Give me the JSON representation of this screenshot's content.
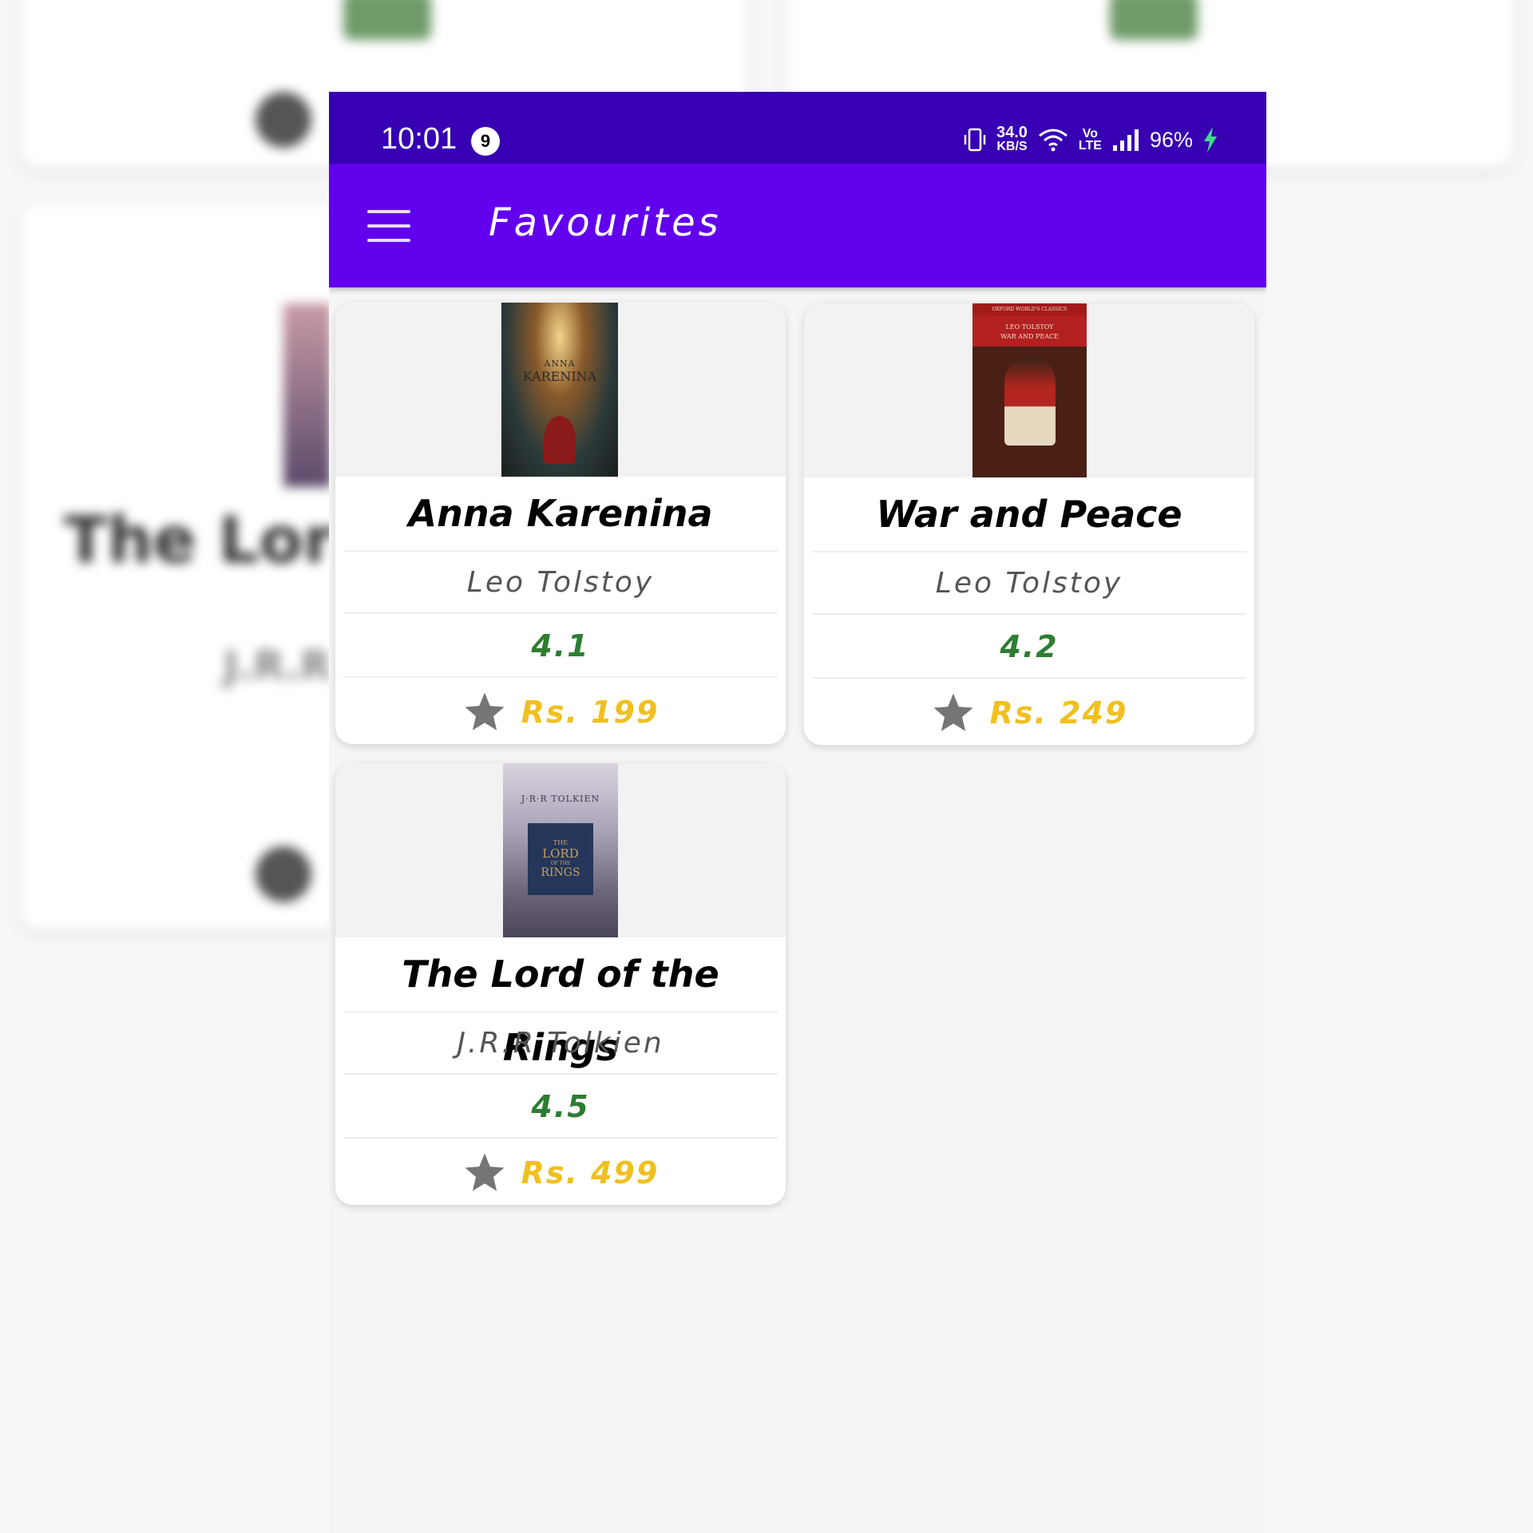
{
  "status_bar": {
    "time": "10:01",
    "notification_count": "9",
    "net_speed_value": "34.0",
    "net_speed_unit": "KB/S",
    "volte_top": "Vo",
    "volte_bottom": "LTE",
    "battery": "96%"
  },
  "app_bar": {
    "title": "Favourites",
    "menu_icon": "hamburger-menu-icon"
  },
  "colors": {
    "status_bar": "#3700b3",
    "app_bar": "#6200ee",
    "rating": "#2e7d32",
    "price": "#f0c020",
    "star": "#757575"
  },
  "books": [
    {
      "title": "Anna Karenina",
      "author": "Leo Tolstoy",
      "rating": "4.1",
      "price": "Rs. 199",
      "cover_text": [
        "ANNA",
        "KARENINA"
      ]
    },
    {
      "title": "War and Peace",
      "author": "Leo Tolstoy",
      "rating": "4.2",
      "price": "Rs. 249",
      "cover_text": [
        "OXFORD WORLD'S CLASSICS",
        "LEO TOLSTOY",
        "WAR AND PEACE"
      ]
    },
    {
      "title": "The Lord of the Rings",
      "author": "J.R.R Tolkien",
      "rating": "4.5",
      "price": "Rs. 499",
      "cover_text": [
        "J·R·R TOLKIEN",
        "THE",
        "LORD",
        "OF THE",
        "RINGS"
      ]
    }
  ],
  "background_blur": {
    "title_fragment": "The Lord",
    "author_fragment": "J.R.R"
  }
}
